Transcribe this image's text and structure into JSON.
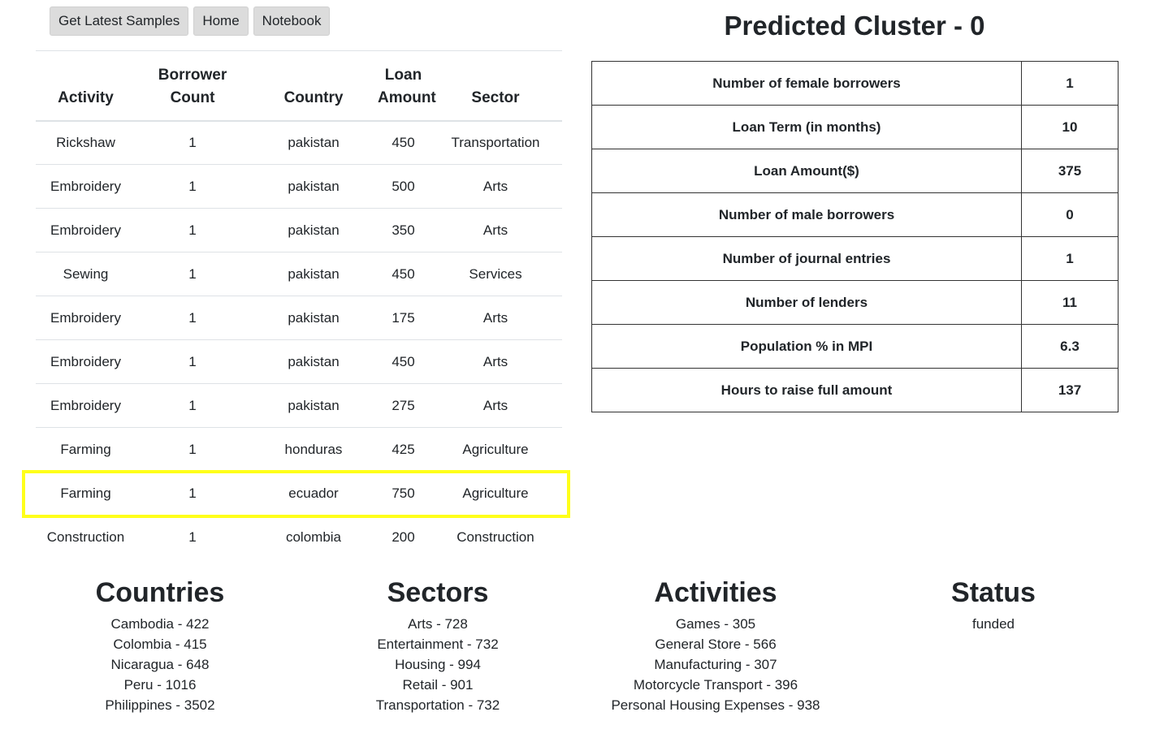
{
  "buttons": {
    "latest": "Get Latest Samples",
    "home": "Home",
    "notebook": "Notebook"
  },
  "samples": {
    "headers": {
      "activity": "Activity",
      "borrower_count": "Borrower Count",
      "country": "Country",
      "loan_amount": "Loan Amount",
      "sector": "Sector"
    },
    "rows": [
      {
        "activity": "Rickshaw",
        "count": "1",
        "country": "pakistan",
        "amount": "450",
        "sector": "Transportation"
      },
      {
        "activity": "Embroidery",
        "count": "1",
        "country": "pakistan",
        "amount": "500",
        "sector": "Arts"
      },
      {
        "activity": "Embroidery",
        "count": "1",
        "country": "pakistan",
        "amount": "350",
        "sector": "Arts"
      },
      {
        "activity": "Sewing",
        "count": "1",
        "country": "pakistan",
        "amount": "450",
        "sector": "Services"
      },
      {
        "activity": "Embroidery",
        "count": "1",
        "country": "pakistan",
        "amount": "175",
        "sector": "Arts"
      },
      {
        "activity": "Embroidery",
        "count": "1",
        "country": "pakistan",
        "amount": "450",
        "sector": "Arts"
      },
      {
        "activity": "Embroidery",
        "count": "1",
        "country": "pakistan",
        "amount": "275",
        "sector": "Arts"
      },
      {
        "activity": "Farming",
        "count": "1",
        "country": "honduras",
        "amount": "425",
        "sector": "Agriculture"
      },
      {
        "activity": "Farming",
        "count": "1",
        "country": "ecuador",
        "amount": "750",
        "sector": "Agriculture"
      },
      {
        "activity": "Construction",
        "count": "1",
        "country": "colombia",
        "amount": "200",
        "sector": "Construction"
      }
    ],
    "highlight_color": "#ffff1a"
  },
  "cluster": {
    "title": "Predicted Cluster - 0",
    "rows": [
      {
        "label": "Number of female borrowers",
        "value": "1"
      },
      {
        "label": "Loan Term (in months)",
        "value": "10"
      },
      {
        "label": "Loan Amount($)",
        "value": "375"
      },
      {
        "label": "Number of male borrowers",
        "value": "0"
      },
      {
        "label": "Number of journal entries",
        "value": "1"
      },
      {
        "label": "Number of lenders",
        "value": "11"
      },
      {
        "label": "Population % in MPI",
        "value": "6.3"
      },
      {
        "label": "Hours to raise full amount",
        "value": "137"
      }
    ]
  },
  "summaries": {
    "countries": {
      "title": "Countries",
      "items": [
        "Cambodia - 422",
        "Colombia - 415",
        "Nicaragua - 648",
        "Peru - 1016",
        "Philippines - 3502"
      ]
    },
    "sectors": {
      "title": "Sectors",
      "items": [
        "Arts - 728",
        "Entertainment - 732",
        "Housing - 994",
        "Retail - 901",
        "Transportation - 732"
      ]
    },
    "activities": {
      "title": "Activities",
      "items": [
        "Games - 305",
        "General Store - 566",
        "Manufacturing - 307",
        "Motorcycle Transport - 396",
        "Personal Housing Expenses - 938"
      ]
    },
    "status": {
      "title": "Status",
      "items": [
        "funded"
      ]
    }
  }
}
